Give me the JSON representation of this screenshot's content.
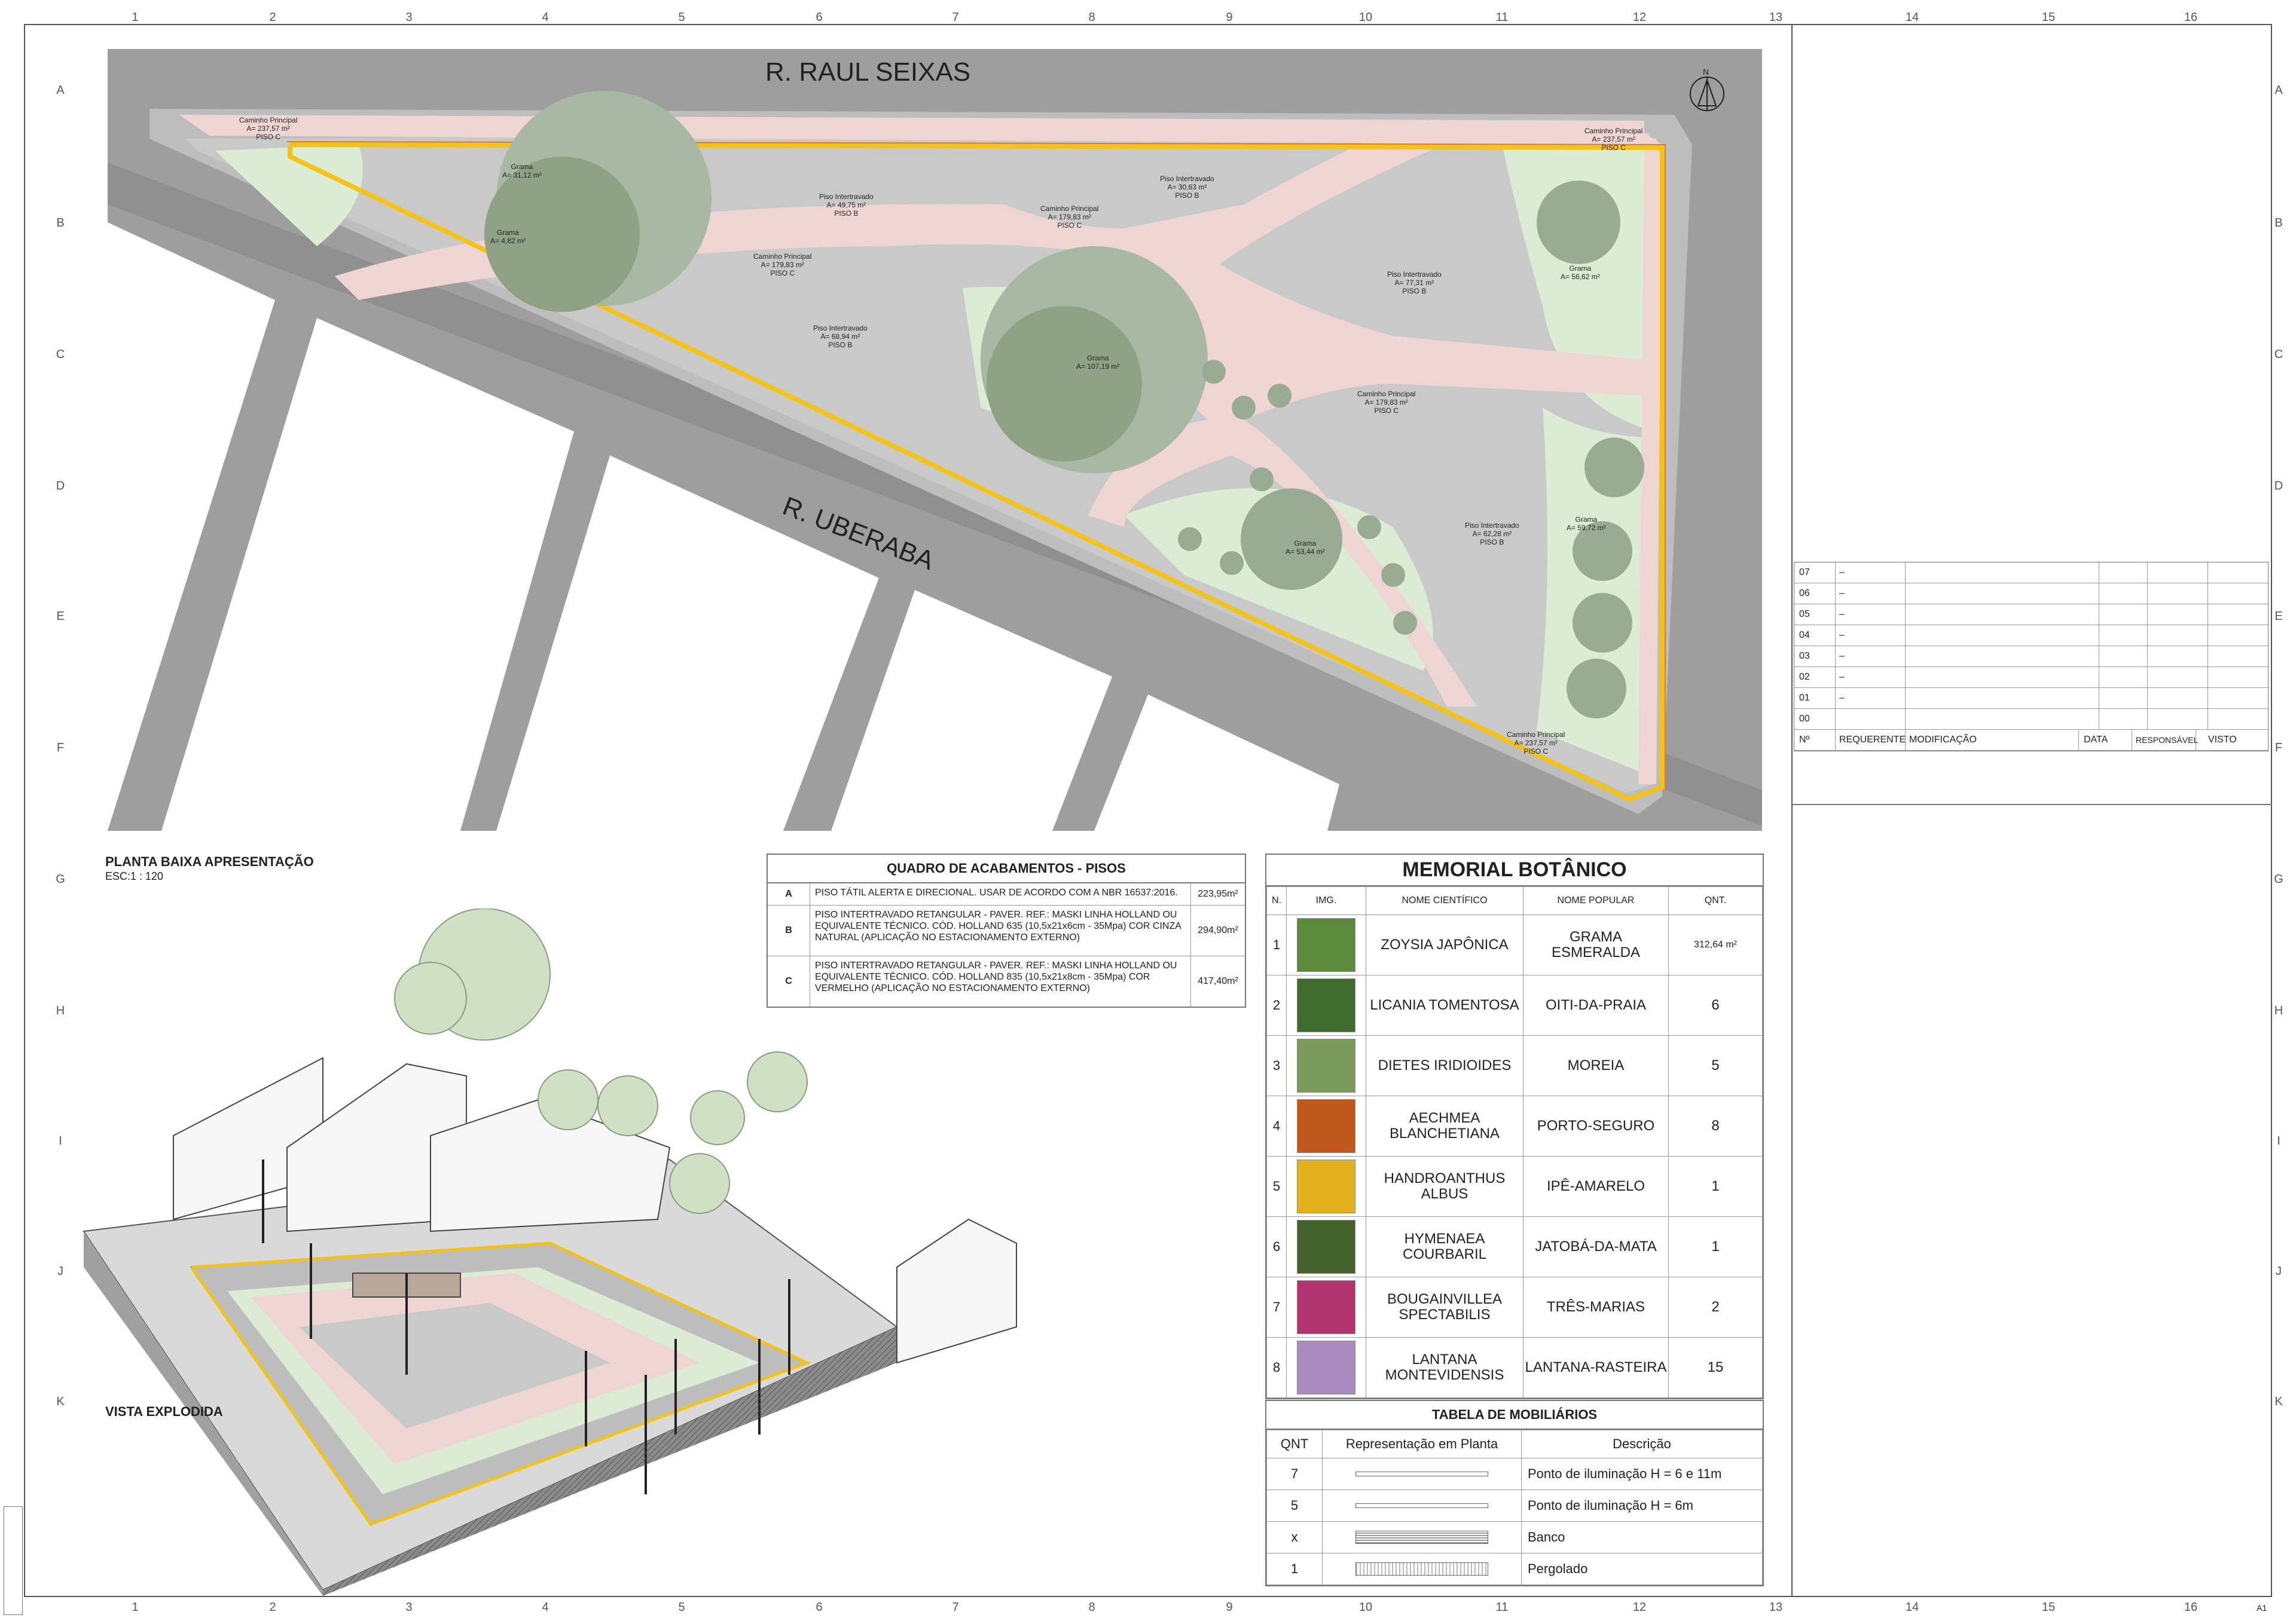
{
  "rulers": {
    "columns": [
      "1",
      "2",
      "3",
      "4",
      "5",
      "6",
      "7",
      "8",
      "9",
      "10",
      "11",
      "12",
      "13",
      "14",
      "15",
      "16"
    ],
    "rows": [
      "A",
      "B",
      "C",
      "D",
      "E",
      "F",
      "G",
      "H",
      "I",
      "J",
      "K"
    ]
  },
  "plan": {
    "street_top": "R. RAUL SEIXAS",
    "street_diag": "R. UBERABA",
    "north": "N",
    "title": "PLANTA BAIXA APRESENTAÇÃO",
    "scale": "ESC:1 : 120",
    "labels": [
      {
        "name": "Caminho Principal",
        "area": "A= 237,57 m²",
        "piso": "PISO C"
      },
      {
        "name": "Caminho Principal",
        "area": "A= 237,57 m²",
        "piso": "PISO C"
      },
      {
        "name": "Grama",
        "area": "A= 31,12 m²",
        "piso": ""
      },
      {
        "name": "Grama",
        "area": "A= 4,82 m²",
        "piso": ""
      },
      {
        "name": "Piso Intertravado",
        "area": "A= 49,75 m²",
        "piso": "PISO B"
      },
      {
        "name": "Piso Intertravado",
        "area": "A= 30,63 m²",
        "piso": "PISO B"
      },
      {
        "name": "Caminho Principal",
        "area": "A= 179,83 m²",
        "piso": "PISO C"
      },
      {
        "name": "Caminho Principal",
        "area": "A= 179,83 m²",
        "piso": "PISO C"
      },
      {
        "name": "Grama",
        "area": "A= 56,62 m²",
        "piso": ""
      },
      {
        "name": "Piso Intertravado",
        "area": "A= 77,31 m²",
        "piso": "PISO B"
      },
      {
        "name": "Piso Intertravado",
        "area": "A= 68,94 m²",
        "piso": "PISO B"
      },
      {
        "name": "Grama",
        "area": "A= 107,19 m²",
        "piso": ""
      },
      {
        "name": "Caminho Principal",
        "area": "A= 179,83 m²",
        "piso": "PISO C"
      },
      {
        "name": "Piso Intertravado",
        "area": "A= 62,28 m²",
        "piso": "PISO B"
      },
      {
        "name": "Grama",
        "area": "A= 59,72 m²",
        "piso": ""
      },
      {
        "name": "Grama",
        "area": "A= 53,44 m²",
        "piso": ""
      },
      {
        "name": "Caminho Principal",
        "area": "A= 237,57 m²",
        "piso": "PISO C"
      }
    ]
  },
  "pisos": {
    "title": "QUADRO DE ACABAMENTOS - PISOS",
    "rows": [
      {
        "key": "A",
        "desc": "PISO TÁTIL ALERTA E DIRECIONAL. USAR DE ACORDO COM A NBR 16537:2016.",
        "value": "223,95m²"
      },
      {
        "key": "B",
        "desc": "PISO INTERTRAVADO RETANGULAR - PAVER. REF.: MASKI LINHA HOLLAND OU EQUIVALENTE TÉCNICO. CÓD. HOLLAND 635 (10,5x21x6cm - 35Mpa) COR CINZA NATURAL (APLICAÇÃO NO ESTACIONAMENTO EXTERNO)",
        "value": "294,90m²"
      },
      {
        "key": "C",
        "desc": "PISO INTERTRAVADO RETANGULAR - PAVER. REF.: MASKI LINHA HOLLAND OU EQUIVALENTE TÉCNICO. CÓD. HOLLAND 835 (10,5x21x8cm - 35Mpa) COR VERMELHO (APLICAÇÃO NO ESTACIONAMENTO EXTERNO)",
        "value": "417,40m²"
      }
    ]
  },
  "memorial": {
    "title": "MEMORIAL BOTÂNICO",
    "headers": [
      "N.",
      "IMG.",
      "NOME CIENTÍFICO",
      "NOME POPULAR",
      "QNT."
    ],
    "rows": [
      {
        "n": "1",
        "sci": "ZOYSIA JAPÔNICA",
        "pop": "GRAMA ESMERALDA",
        "qnt": "312,64 m²",
        "img": "#5c8a3c"
      },
      {
        "n": "2",
        "sci": "LICANIA TOMENTOSA",
        "pop": "OITI-DA-PRAIA",
        "qnt": "6",
        "img": "#3f6b2c"
      },
      {
        "n": "3",
        "sci": "DIETES IRIDIOIDES",
        "pop": "MOREIA",
        "qnt": "5",
        "img": "#7a9a5a"
      },
      {
        "n": "4",
        "sci": "AECHMEA BLANCHETIANA",
        "pop": "PORTO-SEGURO",
        "qnt": "8",
        "img": "#c0571c"
      },
      {
        "n": "5",
        "sci": "HANDROANTHUS ALBUS",
        "pop": "IPÊ-AMARELO",
        "qnt": "1",
        "img": "#e2b11c"
      },
      {
        "n": "6",
        "sci": "HYMENAEA COURBARIL",
        "pop": "JATOBÁ-DA-MATA",
        "qnt": "1",
        "img": "#42632c"
      },
      {
        "n": "7",
        "sci": "BOUGAINVILLEA SPECTABILIS",
        "pop": "TRÊS-MARIAS",
        "qnt": "2",
        "img": "#b2336e"
      },
      {
        "n": "8",
        "sci": "LANTANA MONTEVIDENSIS",
        "pop": "LANTANA-RASTEIRA",
        "qnt": "15",
        "img": "#a98bc0"
      }
    ]
  },
  "mobiliario": {
    "title": "TABELA DE MOBILIÁRIOS",
    "headers": [
      "QNT",
      "Representação em Planta",
      "Descrição"
    ],
    "rows": [
      {
        "qnt": "7",
        "desc": "Ponto de iluminação H = 6 e 11m"
      },
      {
        "qnt": "5",
        "desc": "Ponto de iluminação H = 6m"
      },
      {
        "qnt": "x",
        "desc": "Banco"
      },
      {
        "qnt": "1",
        "desc": "Pergolado"
      }
    ]
  },
  "revisions": {
    "rows": [
      "07",
      "06",
      "05",
      "04",
      "03",
      "02",
      "01",
      "00"
    ],
    "dash": "–",
    "headers": [
      "Nº",
      "REQUERENTE",
      "MODIFICAÇÃO",
      "DATA",
      "RESPONSÁVEL",
      "VISTO"
    ]
  },
  "views": {
    "exploded": "VISTA EXPLODIDA",
    "sheet": "A1"
  },
  "colors": {
    "road": "#9e9e9e",
    "paver_gray": "#c9c9c9",
    "path_pink": "#efd4d4",
    "grass": "#dcebd3",
    "tree": "#93a88a",
    "tactile": "#f3c318"
  }
}
